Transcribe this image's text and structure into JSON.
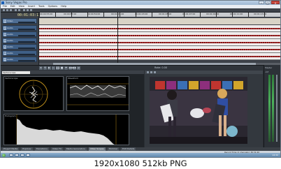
{
  "window": {
    "title": "Sony Vegas Pro",
    "buttons": [
      "–",
      "□",
      "×"
    ]
  },
  "menu": [
    "File",
    "Edit",
    "View",
    "Insert",
    "Tools",
    "Options",
    "Help"
  ],
  "timeline": {
    "timecode": "00:01:03:11",
    "ruler_labels": [
      "00:00:55:00",
      "00:00:57:00",
      "00:00:59:00",
      "00:01:01:00",
      "00:01:03:00",
      "00:01:05:00",
      "00:01:07:00",
      "00:01:09:00",
      "00:01:11:00",
      "00:01:13:00"
    ],
    "tracks": [
      {
        "num": "1",
        "name": "Video"
      },
      {
        "num": "2",
        "name": "Audio"
      },
      {
        "num": "3",
        "name": "Audio"
      },
      {
        "num": "4",
        "name": "Audio"
      },
      {
        "num": "5",
        "name": "Audio"
      },
      {
        "num": "6",
        "name": "Audio"
      },
      {
        "num": "7",
        "name": "Audio"
      }
    ]
  },
  "transport": {
    "rate": "Rate: 0.00",
    "buttons": [
      "⏺",
      "⟲",
      "▶",
      "▷",
      "❚❚",
      "■",
      "⏮",
      "◀◀",
      "▶▶",
      "⏭"
    ]
  },
  "scopes": {
    "selector": "Vectorscope",
    "labels": [
      "Vectorscope",
      "Waveform",
      "Histogram"
    ]
  },
  "mixer": {
    "label_top": "Master",
    "label_bottom": "-Inf"
  },
  "bottom_tabs": [
    "Project Media",
    "Explorer",
    "Transitions",
    "Video FX",
    "Media Generators",
    "Video Scopes",
    "Trimmer",
    "Edit Details"
  ],
  "active_tab_index": 5,
  "status": "Record Time (2 channels): 36:31:20",
  "taskbar": {
    "clock": "14:32"
  },
  "caption": "1920x1080  512kb  PNG"
}
